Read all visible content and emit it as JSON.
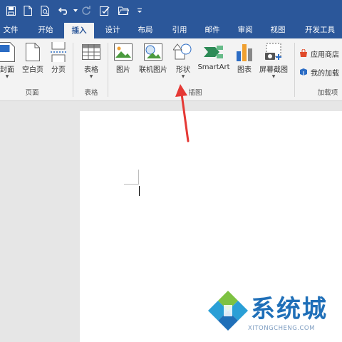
{
  "tabs": [
    "文件",
    "开始",
    "插入",
    "设计",
    "布局",
    "引用",
    "邮件",
    "审阅",
    "视图",
    "开发工具"
  ],
  "active_tab": "插入",
  "ribbon": {
    "pages": {
      "cover": "封面",
      "blank_page": "空白页",
      "page_break": "分页",
      "group": "页面"
    },
    "tables": {
      "table": "表格",
      "group": "表格"
    },
    "illustrations": {
      "pictures": "图片",
      "online_pictures": "联机图片",
      "shapes": "形状",
      "smartart": "SmartArt",
      "chart": "图表",
      "screenshot": "屏幕截图",
      "group": "插图"
    },
    "addins": {
      "store": "应用商店",
      "my_addins": "我的加载",
      "group": "加载项"
    }
  },
  "watermark": {
    "brand": "系统城",
    "url": "XITONGCHENG.COM"
  },
  "colors": {
    "ribbon_blue": "#2b579a",
    "arrow_red": "#e53935",
    "watermark_blue": "#1f6fb8"
  }
}
